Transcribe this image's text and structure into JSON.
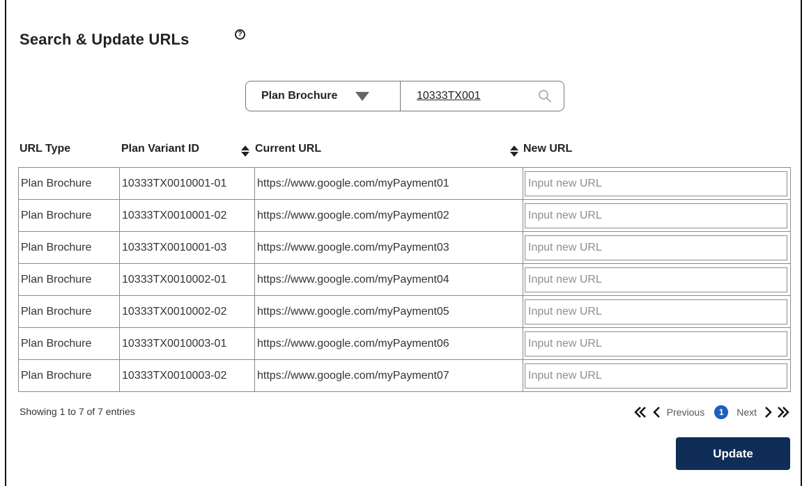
{
  "page": {
    "title": "Search & Update URLs",
    "help_icon": "question-circle-icon",
    "help_glyph": "?"
  },
  "search": {
    "type_selected": "Plan Brochure",
    "query": "10333TX001",
    "search_icon": "magnifier-icon"
  },
  "table": {
    "columns": [
      "URL Type",
      "Plan Variant ID",
      "Current URL",
      "New URL"
    ],
    "sortable_icon": "sort-up-down-icon",
    "input_placeholder": "Input new URL",
    "rows": [
      {
        "url_type": "Plan Brochure",
        "plan_variant_id": "10333TX0010001-01",
        "current_url": "https://www.google.com/myPayment01",
        "new_url": ""
      },
      {
        "url_type": "Plan Brochure",
        "plan_variant_id": "10333TX0010001-02",
        "current_url": "https://www.google.com/myPayment02",
        "new_url": ""
      },
      {
        "url_type": "Plan Brochure",
        "plan_variant_id": "10333TX0010001-03",
        "current_url": "https://www.google.com/myPayment03",
        "new_url": ""
      },
      {
        "url_type": "Plan Brochure",
        "plan_variant_id": "10333TX0010002-01",
        "current_url": "https://www.google.com/myPayment04",
        "new_url": ""
      },
      {
        "url_type": "Plan Brochure",
        "plan_variant_id": "10333TX0010002-02",
        "current_url": "https://www.google.com/myPayment05",
        "new_url": ""
      },
      {
        "url_type": "Plan Brochure",
        "plan_variant_id": "10333TX0010003-01",
        "current_url": "https://www.google.com/myPayment06",
        "new_url": ""
      },
      {
        "url_type": "Plan Brochure",
        "plan_variant_id": "10333TX0010003-02",
        "current_url": "https://www.google.com/myPayment07",
        "new_url": ""
      }
    ]
  },
  "footer": {
    "showing_text": "Showing 1 to 7 of 7 entries",
    "previous_label": "Previous",
    "next_label": "Next",
    "current_page": "1",
    "first_icon": "double-chevron-left-icon",
    "prev_icon": "chevron-left-icon",
    "next_icon": "chevron-right-icon",
    "last_icon": "double-chevron-right-icon"
  },
  "actions": {
    "update_label": "Update"
  },
  "colors": {
    "primary_button": "#0f2d57",
    "page_badge": "#1d5fbf",
    "border": "#8a8a8a"
  }
}
